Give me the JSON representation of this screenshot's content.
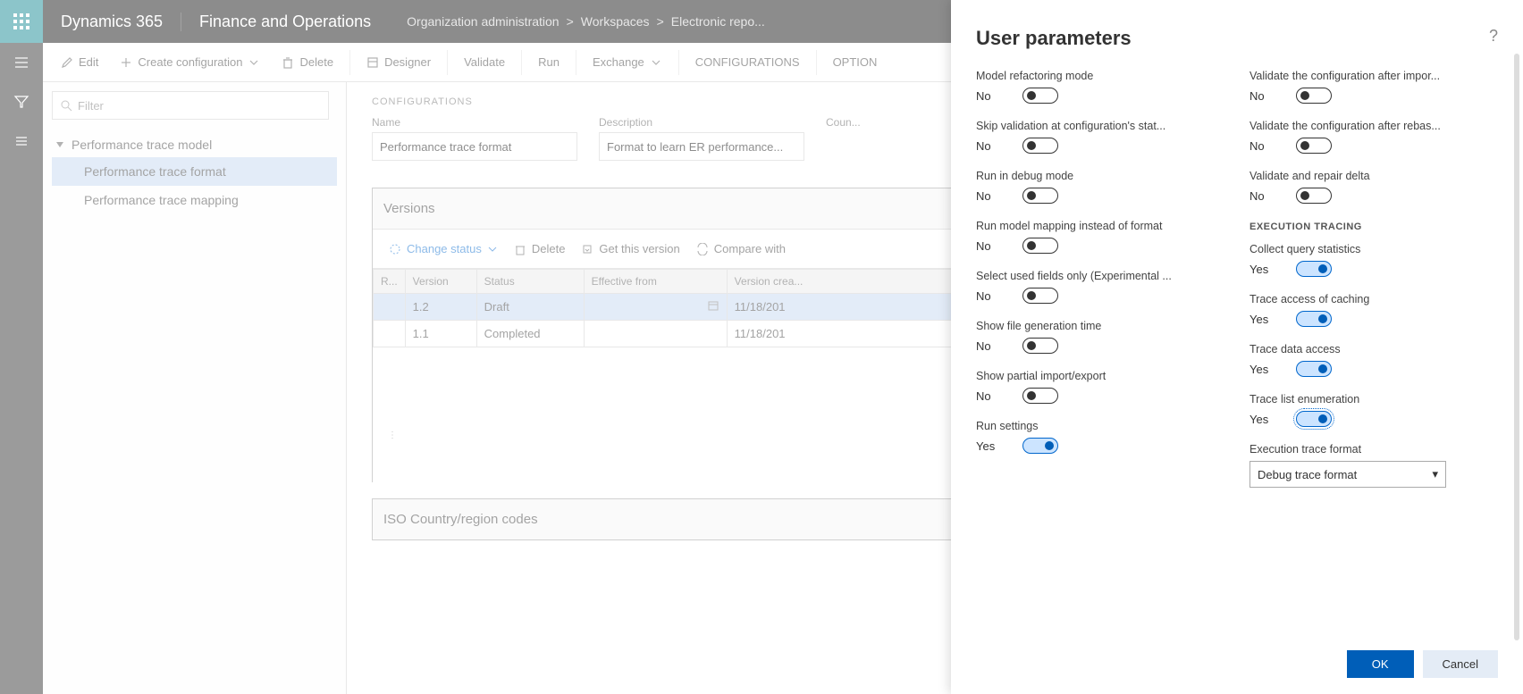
{
  "header": {
    "app": "Dynamics 365",
    "module": "Finance and Operations",
    "breadcrumb": [
      "Organization administration",
      "Workspaces",
      "Electronic repo..."
    ]
  },
  "actionbar": {
    "edit": "Edit",
    "create": "Create configuration",
    "delete": "Delete",
    "designer": "Designer",
    "validate": "Validate",
    "run": "Run",
    "exchange": "Exchange",
    "configurations": "CONFIGURATIONS",
    "options": "OPTION"
  },
  "filter": {
    "placeholder": "Filter"
  },
  "tree": {
    "parent": "Performance trace model",
    "children": [
      {
        "label": "Performance trace format",
        "selected": true
      },
      {
        "label": "Performance trace mapping",
        "selected": false
      }
    ]
  },
  "detail": {
    "section": "CONFIGURATIONS",
    "name_label": "Name",
    "name_value": "Performance trace format",
    "desc_label": "Description",
    "desc_value": "Format to learn ER performance...",
    "country_label": "Coun..."
  },
  "versions": {
    "title": "Versions",
    "change_status": "Change status",
    "delete": "Delete",
    "get_version": "Get this version",
    "compare": "Compare with ",
    "cols": {
      "r": "R...",
      "version": "Version",
      "status": "Status",
      "effective": "Effective from",
      "created": "Version crea..."
    },
    "rows": [
      {
        "version": "1.2",
        "status": "Draft",
        "effective": "",
        "created": "11/18/201",
        "selected": true
      },
      {
        "version": "1.1",
        "status": "Completed",
        "effective": "",
        "created": "11/18/201",
        "selected": false
      }
    ]
  },
  "iso": {
    "title": "ISO Country/region codes"
  },
  "pane": {
    "title": "User parameters",
    "ok": "OK",
    "cancel": "Cancel",
    "left_params": [
      {
        "label": "Model refactoring mode",
        "value": "No",
        "on": false
      },
      {
        "label": "Skip validation at configuration's stat...",
        "value": "No",
        "on": false
      },
      {
        "label": "Run in debug mode",
        "value": "No",
        "on": false
      },
      {
        "label": "Run model mapping instead of format",
        "value": "No",
        "on": false
      },
      {
        "label": "Select used fields only (Experimental ...",
        "value": "No",
        "on": false
      },
      {
        "label": "Show file generation time",
        "value": "No",
        "on": false
      },
      {
        "label": "Show partial import/export",
        "value": "No",
        "on": false
      },
      {
        "label": "Run settings",
        "value": "Yes",
        "on": true
      }
    ],
    "right_top_params": [
      {
        "label": "Validate the configuration after impor...",
        "value": "No",
        "on": false
      },
      {
        "label": "Validate the configuration after rebas...",
        "value": "No",
        "on": false
      },
      {
        "label": "Validate and repair delta",
        "value": "No",
        "on": false
      }
    ],
    "exec_section": "EXECUTION TRACING",
    "right_exec_params": [
      {
        "label": "Collect query statistics",
        "value": "Yes",
        "on": true
      },
      {
        "label": "Trace access of caching",
        "value": "Yes",
        "on": true
      },
      {
        "label": "Trace data access",
        "value": "Yes",
        "on": true
      },
      {
        "label": "Trace list enumeration",
        "value": "Yes",
        "on": true,
        "focused": true
      }
    ],
    "exec_format_label": "Execution trace format",
    "exec_format_value": "Debug trace format"
  }
}
